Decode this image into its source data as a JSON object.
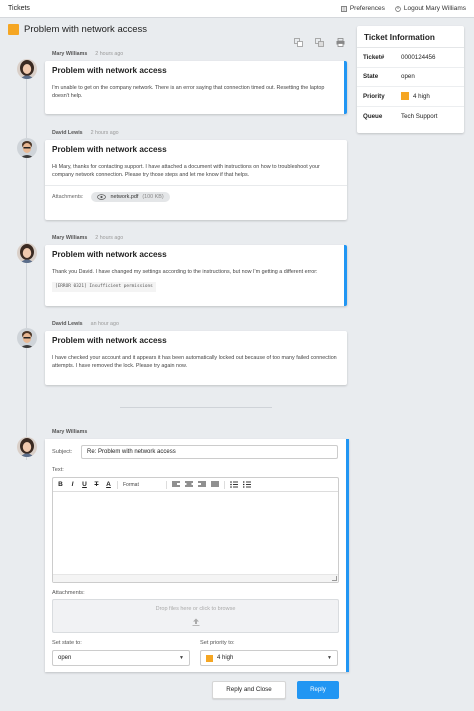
{
  "topbar": {
    "brand": "Tickets",
    "preferences_label": "Preferences",
    "logout_label": "Logout Mary Williams"
  },
  "ticket": {
    "title": "Problem with network access",
    "priority_color": "#f5a623",
    "accent_color": "#2196f3"
  },
  "messages": [
    {
      "author": "Mary Williams",
      "time": "2 hours ago",
      "title": "Problem with network access",
      "body": "I'm unable to get on the company network. There is an error saying that connection timed out. Resetting the laptop doesn't help."
    },
    {
      "author": "David Lewis",
      "time": "2 hours ago",
      "title": "Problem with network access",
      "body": "Hi Mary, thanks for contacting support. I have attached a document with instructions on how to troubleshoot your company network connection. Please try those steps and let me know if that helps.",
      "attachments_label": "Attachments:",
      "attachment_name": "network.pdf",
      "attachment_size": "(100 KB)"
    },
    {
      "author": "Mary Williams",
      "time": "2 hours ago",
      "title": "Problem with network access",
      "body": "Thank you David. I have changed my settings according to the instructions, but now I'm getting a different error:",
      "code": "[ERROR 0321] Insufficient permissions"
    },
    {
      "author": "David Lewis",
      "time": "an hour ago",
      "title": "Problem with network access",
      "body": "I have checked your account and it appears it has been automatically locked out because of too many failed connection attempts. I have removed the lock. Please try again now."
    }
  ],
  "reply": {
    "author": "Mary Williams",
    "subject_label": "Subject:",
    "subject_value": "Re: Problem with network access",
    "text_label": "Text:",
    "format_label": "Format",
    "attachments_label": "Attachments:",
    "dropzone_text": "Drop files here or click to browse",
    "state_label": "Set state to:",
    "state_value": "open",
    "priority_label": "Set priority to:",
    "priority_value": "4 high",
    "reply_close_label": "Reply and Close",
    "reply_label": "Reply"
  },
  "info": {
    "title": "Ticket Information",
    "rows": [
      {
        "key": "Ticket#",
        "value": "0000124456"
      },
      {
        "key": "State",
        "value": "open"
      },
      {
        "key": "Priority",
        "value": "4 high"
      },
      {
        "key": "Queue",
        "value": "Tech Support"
      }
    ]
  }
}
